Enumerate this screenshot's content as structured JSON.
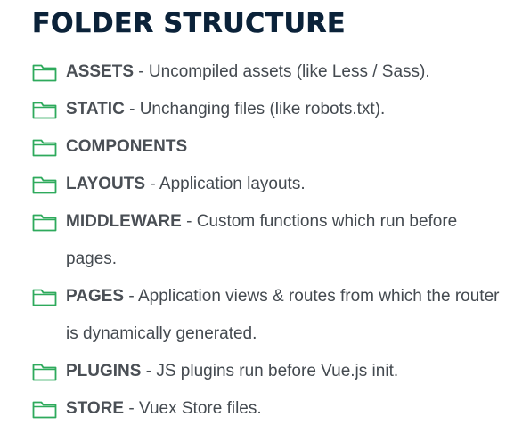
{
  "title": "FOLDER STRUCTURE",
  "accent_color": "#2eaa5c",
  "separator": " - ",
  "items": [
    {
      "icon": "folder-icon",
      "name": "ASSETS",
      "description": "Uncompiled assets (like Less / Sass)."
    },
    {
      "icon": "folder-icon",
      "name": "STATIC",
      "description": "Unchanging files (like robots.txt)."
    },
    {
      "icon": "folder-icon",
      "name": "COMPONENTS",
      "description": ""
    },
    {
      "icon": "folder-icon",
      "name": "LAYOUTS",
      "description": "Application layouts."
    },
    {
      "icon": "folder-icon",
      "name": "MIDDLEWARE",
      "description": "Custom functions which run before pages."
    },
    {
      "icon": "folder-icon",
      "name": "PAGES",
      "description": "Application views & routes from which the router is dynamically generated."
    },
    {
      "icon": "folder-icon",
      "name": "PLUGINS",
      "description": "JS plugins run before Vue.js init."
    },
    {
      "icon": "folder-icon",
      "name": "STORE",
      "description": "Vuex Store files."
    }
  ]
}
